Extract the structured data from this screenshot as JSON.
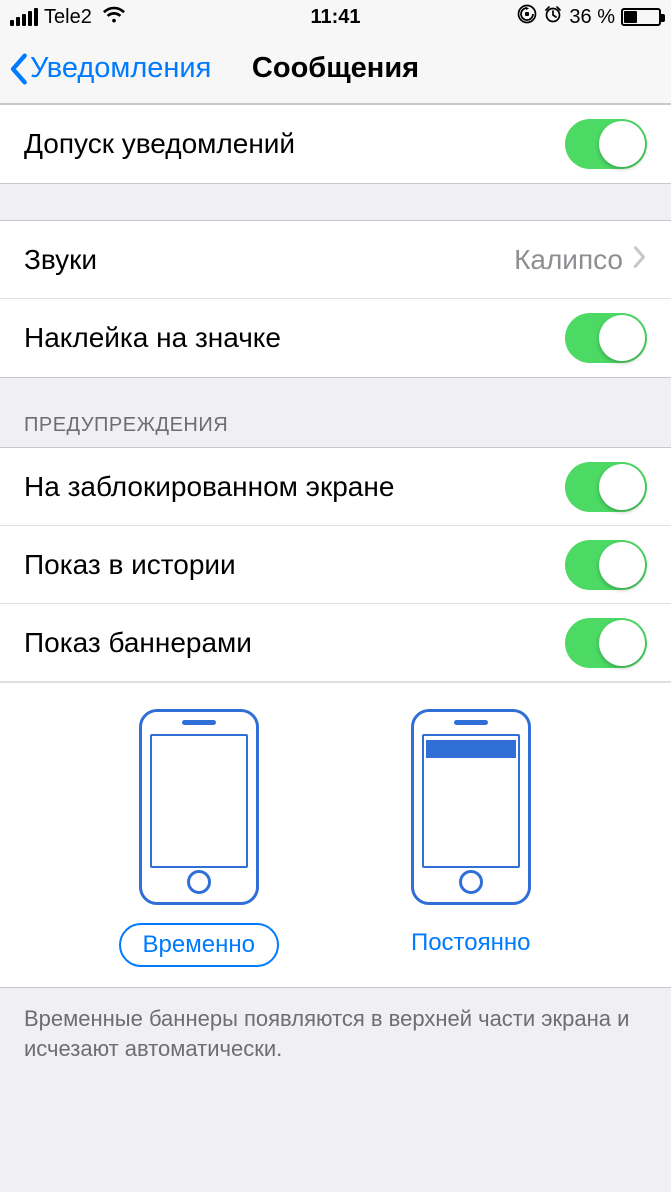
{
  "status": {
    "carrier": "Tele2",
    "time": "11:41",
    "battery_text": "36 %",
    "battery_level": 36
  },
  "nav": {
    "back_label": "Уведомления",
    "title": "Сообщения"
  },
  "rows": {
    "allow_notifications": "Допуск уведомлений",
    "sounds_label": "Звуки",
    "sounds_value": "Калипсо",
    "badge": "Наклейка на значке",
    "section_alerts": "ПРЕДУПРЕЖДЕНИЯ",
    "lock_screen": "На заблокированном экране",
    "history": "Показ в истории",
    "banners": "Показ баннерами"
  },
  "banner_style": {
    "option_temporary": "Временно",
    "option_persistent": "Постоянно",
    "selected": "temporary"
  },
  "footer": "Временные баннеры появляются в верхней части экрана и исчезают автоматически.",
  "toggles": {
    "allow_notifications": true,
    "badge": true,
    "lock_screen": true,
    "history": true,
    "banners": true
  }
}
